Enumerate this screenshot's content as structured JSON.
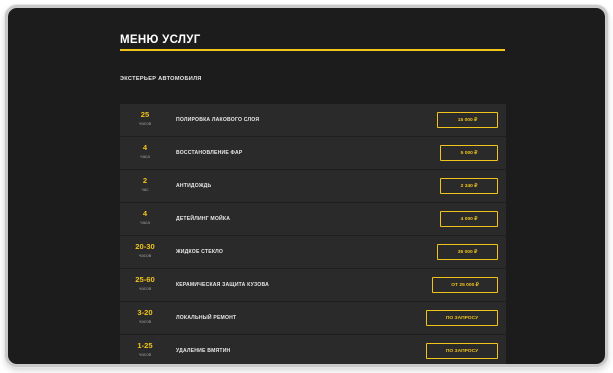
{
  "page": {
    "title": "МЕНЮ УСЛУГ",
    "section_label": "ЭКСТЕРЬЕР АВТОМОБИЛЯ"
  },
  "colors": {
    "accent": "#f0c419",
    "background": "#1c1c1c",
    "panel": "#2a2a2a"
  },
  "services": [
    {
      "duration": "25",
      "unit": "часов",
      "name": "ПОЛИРОВКА ЛАКОВОГО СЛОЯ",
      "price": "15 000 ₽"
    },
    {
      "duration": "4",
      "unit": "часа",
      "name": "ВОССТАНОВЛЕНИЕ ФАР",
      "price": "5 000 ₽"
    },
    {
      "duration": "2",
      "unit": "час",
      "name": "АНТИДОЖДЬ",
      "price": "2 340 ₽"
    },
    {
      "duration": "4",
      "unit": "часа",
      "name": "ДЕТЕЙЛИНГ МОЙКА",
      "price": "4 000 ₽"
    },
    {
      "duration": "20-30",
      "unit": "часов",
      "name": "ЖИДКОЕ СТЕКЛО",
      "price": "35 000 ₽"
    },
    {
      "duration": "25-60",
      "unit": "часов",
      "name": "КЕРАМИЧЕСКАЯ ЗАЩИТА КУЗОВА",
      "price": "ОТ 25 000 ₽"
    },
    {
      "duration": "3-20",
      "unit": "часов",
      "name": "ЛОКАЛЬНЫЙ РЕМОНТ",
      "price": "ПО ЗАПРОСУ"
    },
    {
      "duration": "1-25",
      "unit": "часов",
      "name": "УДАЛЕНИЕ ВМЯТИН",
      "price": "ПО ЗАПРОСУ"
    }
  ]
}
